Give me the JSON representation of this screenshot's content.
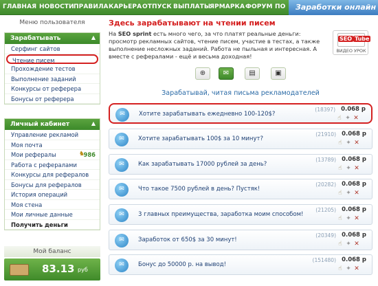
{
  "topnav": {
    "items": [
      "ГЛАВНАЯ",
      "НОВОСТИ",
      "ПРАВИЛА",
      "КАРЬЕРА",
      "ОТПУСК",
      "ВЫПЛАТЫ",
      "ЯРМАРКА",
      "ФОРУМ",
      "ПО"
    ],
    "logo_text": "Заработки онлайн"
  },
  "sidebar": {
    "menu_title": "Меню пользователя",
    "earn_panel": {
      "title": "Зарабатывать",
      "items": [
        "Серфинг сайтов",
        "Чтение писем",
        "Прохождение тестов",
        "Выполнение заданий",
        "Конкурсы от реферера",
        "Бонусы от реферера"
      ]
    },
    "cabinet_panel": {
      "title": "Личный кабинет",
      "items": [
        "Управление рекламой",
        "Моя почта",
        "Мои рефералы",
        "Работа с рефералами",
        "Конкурсы для рефералов",
        "Бонусы для рефералов",
        "История операций",
        "Моя стена",
        "Мои личные данные",
        "Получить деньги"
      ],
      "referrals_count": "986"
    },
    "balance": {
      "title": "Мой баланс",
      "amount": "83.13",
      "currency": "руб"
    }
  },
  "main": {
    "title": "Здесь зарабатывают на чтении писем",
    "intro_brand": "SEO sprint",
    "intro_prefix": "На ",
    "intro_text": " есть много чего, за что платят реальные деньги: просмотр рекламных сайтов, чтение писем, участие в тестах, а также выполнение несложных заданий. Работа не пыльная и интересная. А вместе с рефералами - ещё и весьма доходная!",
    "seo_badge": {
      "logo_left": "SEO",
      "logo_right": "Tube",
      "caption": "ВИДЕО УРОК"
    },
    "list_title": "Зарабатывай, читая письма рекламодателей",
    "emails": [
      {
        "title": "Хотите зарабатывать ежедневно 100-120$?",
        "count": "(18397)",
        "price": "0.068 р"
      },
      {
        "title": "Хотите зарабатывать 100$ за 10 минут?",
        "count": "(21910)",
        "price": "0.068 р"
      },
      {
        "title": "Как зарабатывать 17000 рублей за день?",
        "count": "(13789)",
        "price": "0.068 р"
      },
      {
        "title": "Что такое 7500 рублей в день? Пустяк!",
        "count": "(20282)",
        "price": "0.068 р"
      },
      {
        "title": "3 главных преимущества, заработка моим способом!",
        "count": "(21205)",
        "price": "0.068 р"
      },
      {
        "title": "Заработок от 650$ за 30 минут!",
        "count": "(20349)",
        "price": "0.068 р"
      },
      {
        "title": "Бонус до 50000 р. на вывод!",
        "count": "(151480)",
        "price": "0.068 р"
      }
    ]
  },
  "icons": {
    "caret": "chevron-up-icon",
    "mail": "envelope-icon",
    "wallet": "wallet-icon",
    "vip": "vip-star-icon"
  },
  "colors": {
    "brand_green": "#3f8a2c",
    "highlight_red": "#d42020",
    "title_red": "#d41d1d",
    "link_blue": "#1d3f73"
  }
}
